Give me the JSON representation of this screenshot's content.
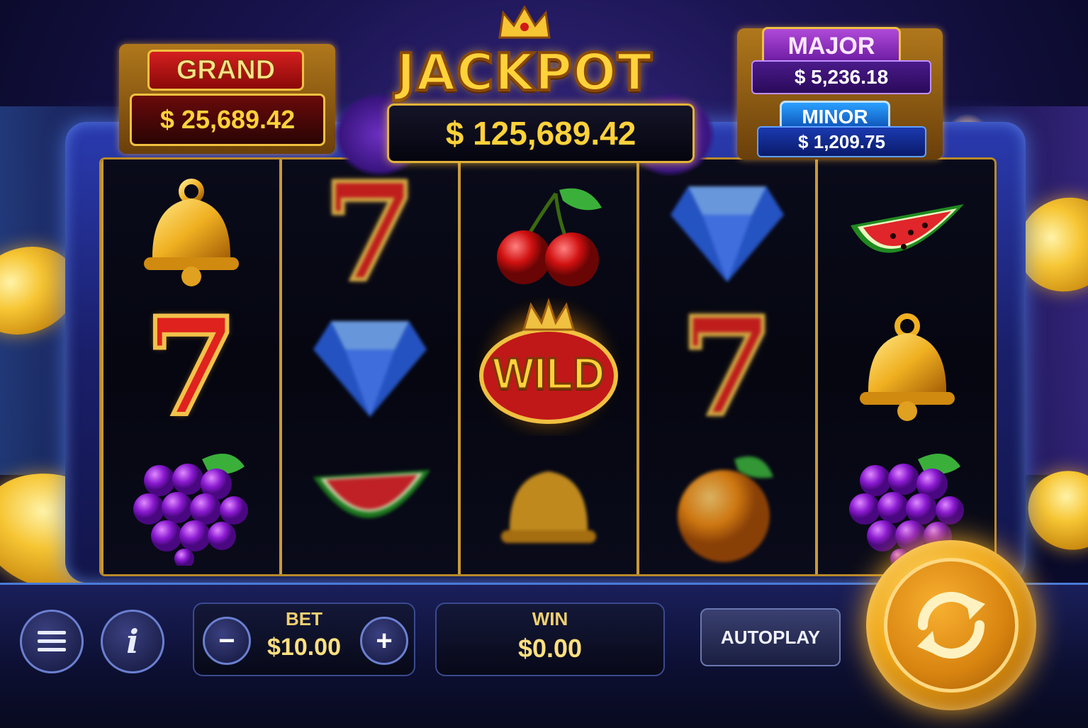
{
  "jackpot": {
    "title": "JACKPOT",
    "value": "$ 125,689.42",
    "grand": {
      "label": "GRAND",
      "value": "$ 25,689.42"
    },
    "major": {
      "label": "MAJOR",
      "value": "$ 5,236.18"
    },
    "minor": {
      "label": "MINOR",
      "value": "$ 1,209.75"
    }
  },
  "reels": [
    [
      "bell",
      "seven",
      "grapes"
    ],
    [
      "seven",
      "diamond",
      "watermelon"
    ],
    [
      "cherry",
      "wild",
      "bell"
    ],
    [
      "diamond",
      "seven",
      "orange"
    ],
    [
      "watermelon",
      "bell",
      "grapes"
    ]
  ],
  "wild_label": "WILD",
  "seven_glyph": "7",
  "controls": {
    "menu_icon": "menu-icon",
    "info_icon": "info-icon",
    "info_glyph": "i",
    "bet_label": "BET",
    "bet_value": "$10.00",
    "minus": "−",
    "plus": "+",
    "win_label": "WIN",
    "win_value": "$0.00",
    "autoplay_label": "AUTOPLAY",
    "spin_icon": "refresh-icon"
  },
  "colors": {
    "gold": "#ffd23a",
    "grand_red": "#d41f1f",
    "major_purple": "#b04ad8",
    "minor_blue": "#2aa0ff"
  }
}
